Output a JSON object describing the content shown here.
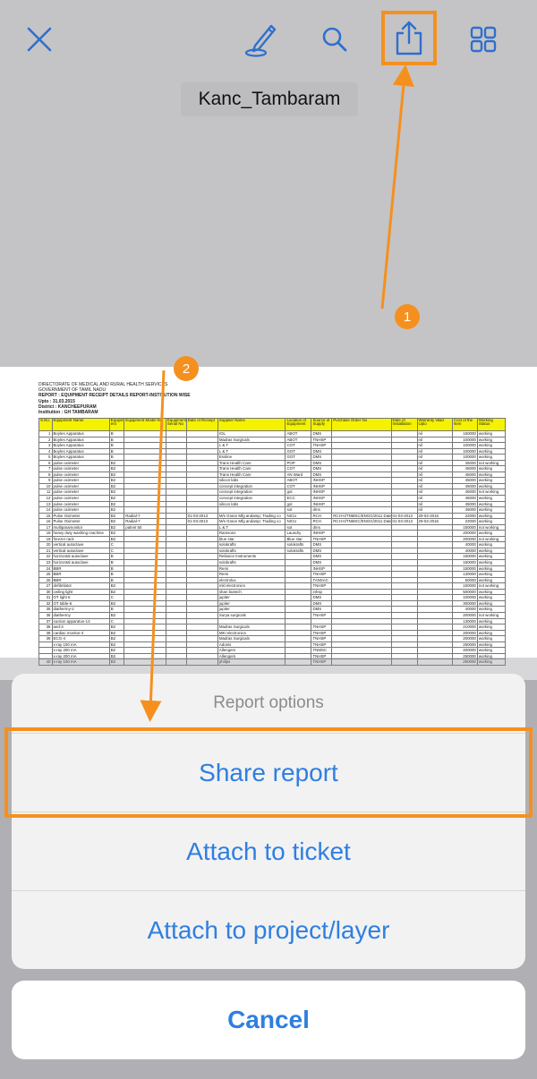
{
  "toolbar": {
    "close_icon": "close-icon",
    "markup_icon": "pen-markup-icon",
    "search_icon": "search-icon",
    "share_icon": "share-icon",
    "grid_icon": "grid-icon",
    "icon_color": "#2f6fce"
  },
  "document": {
    "title": "Kanc_Tambaram",
    "header_lines": [
      "DIRECTORATE OF MEDICAL AND RURAL HEALTH SERVICES",
      "GOVERNMENT OF TAMIL NADU",
      "REPORT : EQUIPMENT RECEIPT DETAILS REPORT-INSTITUTION WISE",
      "Upto : 31.03.2015",
      "District : KANCHEEPURAM",
      "Institution : GH TAMBARAM"
    ],
    "table": {
      "columns": [
        "S.No.",
        "Equipment Name",
        "Equipm ent",
        "Equipment Model No",
        "Equipment Serial No",
        "Date of Receipt",
        "Supplier Name",
        "Location of Equipment",
        "Source of Supply",
        "Purchase Order No",
        "Date of Installation",
        "Warranty Valid Upto",
        "Cost of the Item",
        "Working Status"
      ],
      "rows": [
        [
          "1",
          "Boyles Apparatus",
          "B",
          "",
          "",
          "",
          "IOL",
          "ABOT",
          "DMS",
          "",
          "",
          "nil",
          "150000",
          "working"
        ],
        [
          "2",
          "Boyles Apparatus",
          "B",
          "",
          "",
          "",
          "Madras Surgicals",
          "ABOT",
          "TNHSP",
          "",
          "",
          "nil",
          "100000",
          "working"
        ],
        [
          "3",
          "Boyles Apparatus",
          "B",
          "",
          "",
          "",
          "L & T",
          "COT",
          "TNHSP",
          "",
          "",
          "nil",
          "100000",
          "working"
        ],
        [
          "4",
          "Boyles Apparatus",
          "B",
          "",
          "",
          "",
          "L & T",
          "GOT",
          "DMS",
          "",
          "",
          "nil",
          "100000",
          "working"
        ],
        [
          "5",
          "Boyles Apparatus",
          "B",
          "",
          "",
          "",
          "Essline",
          "GOT",
          "DMS",
          "",
          "",
          "nil",
          "100000",
          "working"
        ],
        [
          "6",
          "pulse oximeter",
          "B2",
          "",
          "",
          "",
          "Trans Health Care",
          "POP",
          "DMS",
          "",
          "",
          "nil",
          "45000",
          "not working"
        ],
        [
          "7",
          "pulse oximeter",
          "B2",
          "",
          "",
          "",
          "Trans Health Care",
          "COT",
          "DMS",
          "",
          "",
          "nil",
          "45000",
          "working"
        ],
        [
          "8",
          "pulse oximeter",
          "B2",
          "",
          "",
          "",
          "Trans Health Care",
          "AN Ward",
          "DMS",
          "",
          "",
          "nil",
          "45000",
          "working"
        ],
        [
          "9",
          "pulse oximeter",
          "B2",
          "",
          "",
          "",
          "silicon labs",
          "ABOT",
          "INHSP",
          "",
          "",
          "nil",
          "45000",
          "working"
        ],
        [
          "10",
          "pulse oximeter",
          "B2",
          "",
          "",
          "",
          "concept integration",
          "COT",
          "INHSP",
          "",
          "",
          "nil",
          "45000",
          "working"
        ],
        [
          "11",
          "pulse oximeter",
          "B2",
          "",
          "",
          "",
          "concept integration",
          "got",
          "INHSP",
          "",
          "",
          "nil",
          "45000",
          "not working"
        ],
        [
          "12",
          "pulse oximeter",
          "B2",
          "",
          "",
          "",
          "concept integration",
          "ECC",
          "INHSP",
          "",
          "",
          "nil",
          "45000",
          "working"
        ],
        [
          "13",
          "pulse oximeter",
          "B2",
          "",
          "",
          "",
          "silicon labs",
          "got",
          "INHSP",
          "",
          "",
          "nil",
          "45000",
          "working"
        ],
        [
          "14",
          "pulse oximeter",
          "B2",
          "",
          "",
          "",
          "",
          "sot",
          "dms",
          "",
          "",
          "nil",
          "45000",
          "working"
        ],
        [
          "15",
          "Pulse Oximeter",
          "B2",
          "Radial-7",
          "",
          "01-03-2013",
          "M/s Grace Mfg andamp; Trading co",
          "NICU",
          "RCH",
          "RCH-II/TNMSC/ENGG/2011 Dated 10.05.2012",
          "01-03-2013",
          "29-02-2016",
          "22000",
          "working"
        ],
        [
          "16",
          "Pulse Oximeter",
          "B2",
          "Radial-7",
          "",
          "01-03-2013",
          "M/s Grace Mfg andamp; Trading co",
          "NICU",
          "RCH",
          "RCH-II/TNMSC/ENGG/2011 Dated 10.05.2012",
          "01-03-2013",
          "29-02-2016",
          "22000",
          "working"
        ],
        [
          "17",
          "multiparamonitor",
          "B2",
          "palnet 50",
          "",
          "",
          "L & T",
          "sot",
          "dms",
          "",
          "",
          "",
          "150000",
          "not working"
        ],
        [
          "18",
          "heavy duty washing machine",
          "B2",
          "",
          "",
          "",
          "Ramsons",
          "Laundry",
          "INHSP",
          "",
          "",
          "",
          "200000",
          "working"
        ],
        [
          "19",
          "freezer rack",
          "B2",
          "",
          "",
          "",
          "blue star",
          "Blue star",
          "TNHSP",
          "",
          "",
          "",
          "200000",
          "not working"
        ],
        [
          "20",
          "vertical autoclave",
          "C",
          "",
          "",
          "",
          "solokrafts",
          "solokrafts",
          "DMS",
          "",
          "",
          "",
          "40000",
          "working"
        ],
        [
          "21",
          "vertical autoclave",
          "C",
          "",
          "",
          "",
          "solokrafts",
          "solokrafts",
          "DMS",
          "",
          "",
          "",
          "40000",
          "working"
        ],
        [
          "22",
          "horizontal autoclave",
          "B",
          "",
          "",
          "",
          "Reliance Instruments",
          "",
          "DMS",
          "",
          "",
          "",
          "150000",
          "working"
        ],
        [
          "23",
          "horizontal autoclave",
          "B",
          "",
          "",
          "",
          "solokrafts",
          "",
          "DMS",
          "",
          "",
          "",
          "150000",
          "working"
        ],
        [
          "24",
          "BBR",
          "B",
          "",
          "",
          "",
          "Remi",
          "",
          "INHSP",
          "",
          "",
          "",
          "150000",
          "working"
        ],
        [
          "25",
          "BBR",
          "B",
          "",
          "",
          "",
          "Remi",
          "",
          "TNHSP",
          "",
          "",
          "",
          "130000",
          "working"
        ],
        [
          "26",
          "BBR",
          "B",
          "",
          "",
          "",
          "electrolux",
          "",
          "TANSAC",
          "",
          "",
          "",
          "50000",
          "working"
        ],
        [
          "27",
          "defibrilator",
          "B2",
          "",
          "",
          "",
          "mkl electronics",
          "",
          "TNHSP",
          "",
          "",
          "",
          "150000",
          "not working"
        ],
        [
          "30",
          "ceiling light",
          "B2",
          "",
          "",
          "",
          "shan biotech",
          "",
          "inhsp",
          "",
          "",
          "",
          "500000",
          "working"
        ],
        [
          "31",
          "OT light 6",
          "C",
          "",
          "",
          "",
          "jupiter",
          "",
          "DMS",
          "",
          "",
          "",
          "100000",
          "working"
        ],
        [
          "32",
          "OT table-6",
          "B2",
          "",
          "",
          "",
          "jupiter",
          "",
          "DMS",
          "",
          "",
          "",
          "300000",
          "working"
        ],
        [
          "35",
          "diathermy-2",
          "B",
          "",
          "",
          "",
          "jupiter",
          "",
          "DMS",
          "",
          "",
          "",
          "40000",
          "working"
        ],
        [
          "36",
          "diathermy",
          "B2",
          "",
          "",
          "",
          "Surya surgicals",
          "",
          "TNHSP",
          "",
          "",
          "",
          "200000",
          "not working"
        ],
        [
          "37",
          "suction apparatus-13",
          "C",
          "",
          "",
          "",
          "",
          "",
          "",
          "",
          "",
          "",
          "130000",
          "working"
        ],
        [
          "38",
          "aed-3",
          "B2",
          "",
          "",
          "",
          "Madras Surgicals",
          "",
          "TNHSP",
          "",
          "",
          "",
          "210000",
          "working"
        ],
        [
          "38",
          "cardiac monitor-4",
          "B2",
          "",
          "",
          "",
          "MKI electronics",
          "",
          "TNHSP",
          "",
          "",
          "",
          "200000",
          "working"
        ],
        [
          "39",
          "ECG-4",
          "B2",
          "",
          "",
          "",
          "Madras Surgicals",
          "",
          "TNHSP",
          "",
          "",
          "",
          "200000",
          "working"
        ],
        [
          "",
          "x-ray 100 mA",
          "B2",
          "",
          "",
          "",
          "Adonis",
          "",
          "TNHSP",
          "",
          "",
          "",
          "250000",
          "working"
        ],
        [
          "",
          "x-ray 200 mA",
          "B2",
          "",
          "",
          "",
          "Allengers",
          "",
          "TNMSC",
          "",
          "",
          "",
          "400000",
          "working"
        ],
        [
          "",
          "x-ray 200 mA",
          "B2",
          "",
          "",
          "",
          "Allengers",
          "",
          "TNHSP",
          "",
          "",
          "",
          "250000",
          "working"
        ],
        [
          "40",
          "x-ray 100 mA",
          "B2",
          "",
          "",
          "",
          "philips",
          "",
          "TNHSP",
          "",
          "",
          "",
          "250000",
          "working"
        ]
      ]
    }
  },
  "annotations": {
    "step1": "1",
    "step2": "2",
    "accent_color": "#f5901e"
  },
  "sheet": {
    "title": "Report options",
    "options": [
      {
        "label": "Share report"
      },
      {
        "label": "Attach to ticket"
      },
      {
        "label": "Attach to project/layer"
      }
    ],
    "cancel_label": "Cancel"
  }
}
